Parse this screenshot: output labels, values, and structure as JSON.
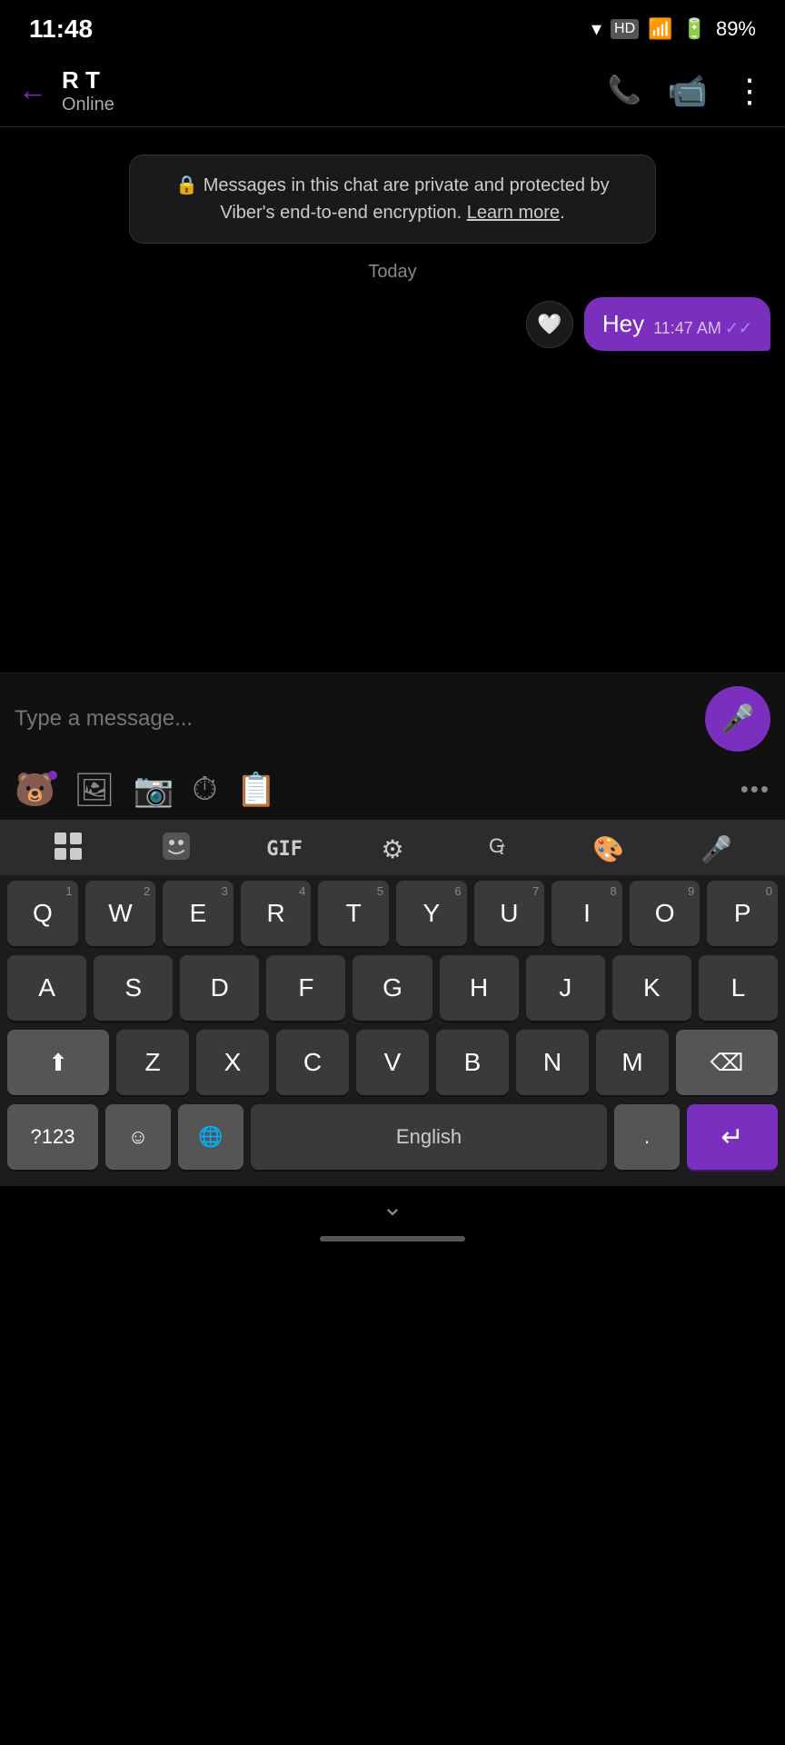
{
  "status": {
    "time": "11:48",
    "battery": "89%",
    "battery_icon": "🔋",
    "wifi_icon": "▼",
    "signal_icon": "▲"
  },
  "header": {
    "back_label": "←",
    "contact_name": "R T",
    "contact_status": "Online",
    "call_icon": "📞",
    "video_icon": "📷",
    "more_icon": "⋮"
  },
  "chat": {
    "encryption_msg": "Messages in this chat are private and protected by Viber's end-to-end encryption.",
    "learn_more": "Learn more",
    "date_label": "Today",
    "message": {
      "text": "Hey",
      "time": "11:47 AM",
      "ticks": "✓✓",
      "reaction_icon": "🤍"
    }
  },
  "input": {
    "placeholder": "Type a message...",
    "voice_icon": "🎤"
  },
  "toolbar": {
    "sticker_icon": "🐻",
    "photo_icon": "🖼",
    "camera_icon": "📷",
    "timer_icon": "⏱",
    "note_icon": "📋",
    "more_label": "•••"
  },
  "keyboard": {
    "top_bar": {
      "apps_icon": "⊞",
      "face_icon": "😊",
      "gif_label": "GIF",
      "settings_icon": "⚙",
      "translate_icon": "🔤",
      "palette_icon": "🎨",
      "mic_icon": "🎤"
    },
    "rows": [
      [
        "Q",
        "W",
        "E",
        "R",
        "T",
        "Y",
        "U",
        "I",
        "O",
        "P"
      ],
      [
        "A",
        "S",
        "D",
        "F",
        "G",
        "H",
        "J",
        "K",
        "L"
      ],
      [
        "Z",
        "X",
        "C",
        "V",
        "B",
        "N",
        "M"
      ]
    ],
    "num_hints": [
      "1",
      "2",
      "3",
      "4",
      "5",
      "6",
      "7",
      "8",
      "9",
      "0"
    ],
    "shift_icon": "⬆",
    "delete_icon": "⌫",
    "num_sym_label": "?123",
    "emoji_icon": "☺",
    "globe_icon": "🌐",
    "space_label": "English",
    "period_label": ".",
    "enter_icon": "↵"
  },
  "nav": {
    "chevron": "⌄"
  }
}
